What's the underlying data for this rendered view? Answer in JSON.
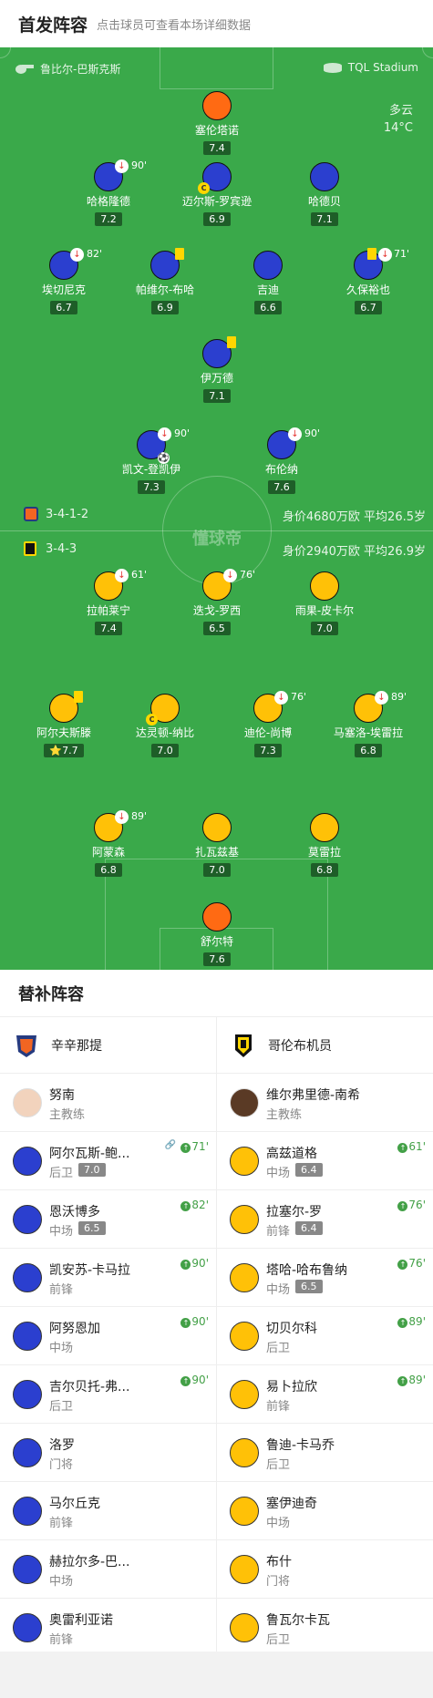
{
  "header": {
    "title": "首发阵容",
    "subtitle": "点击球员可查看本场详细数据"
  },
  "venue": {
    "referee": "鲁比尔-巴斯克斯",
    "stadium": "TQL Stadium"
  },
  "weather": {
    "condition": "多云",
    "temp": "14°C"
  },
  "teams": {
    "home": {
      "formation": "3-4-1-2",
      "value": "身价4680万欧 平均26.5岁"
    },
    "away": {
      "formation": "3-4-3",
      "value": "身价2940万欧 平均26.9岁"
    }
  },
  "watermark": "懂球帝",
  "home_players": [
    {
      "name": "塞伦塔诺",
      "rating": "7.4"
    },
    {
      "name": "哈格隆德",
      "rating": "7.2",
      "sub": "90'"
    },
    {
      "name": "迈尔斯-罗宾逊",
      "rating": "6.9"
    },
    {
      "name": "哈德贝",
      "rating": "7.1"
    },
    {
      "name": "埃切尼克",
      "rating": "6.7",
      "sub": "82'"
    },
    {
      "name": "帕维尔-布哈",
      "rating": "6.9"
    },
    {
      "name": "吉迪",
      "rating": "6.6"
    },
    {
      "name": "久保裕也",
      "rating": "6.7",
      "sub": "71'"
    },
    {
      "name": "伊万德",
      "rating": "7.1"
    },
    {
      "name": "凯文-登凯伊",
      "rating": "7.3",
      "sub": "90'"
    },
    {
      "name": "布伦纳",
      "rating": "7.6",
      "sub": "90'"
    }
  ],
  "away_players": [
    {
      "name": "拉帕莱宁",
      "rating": "7.4",
      "sub": "61'"
    },
    {
      "name": "迭戈-罗西",
      "rating": "6.5",
      "sub": "76'"
    },
    {
      "name": "雨果-皮卡尔",
      "rating": "7.0"
    },
    {
      "name": "阿尔夫斯滕",
      "rating": "7.7"
    },
    {
      "name": "达灵顿-纳比",
      "rating": "7.0"
    },
    {
      "name": "迪伦-尚博",
      "rating": "7.3",
      "sub": "76'"
    },
    {
      "name": "马塞洛-埃雷拉",
      "rating": "6.8",
      "sub": "89'"
    },
    {
      "name": "阿蒙森",
      "rating": "6.8",
      "sub": "89'"
    },
    {
      "name": "扎瓦兹基",
      "rating": "7.0"
    },
    {
      "name": "莫雷拉",
      "rating": "6.8"
    },
    {
      "name": "舒尔特",
      "rating": "7.6"
    }
  ],
  "subs_title": "替补阵容",
  "home_bench": {
    "team": "辛辛那提",
    "coach": {
      "name": "努南",
      "role": "主教练"
    },
    "players": [
      {
        "name": "阿尔瓦斯-鲍...",
        "pos": "后卫",
        "rating": "7.0",
        "min": "71'"
      },
      {
        "name": "恩沃博多",
        "pos": "中场",
        "rating": "6.5",
        "min": "82'"
      },
      {
        "name": "凯安苏-卡马拉",
        "pos": "前锋",
        "min": "90'"
      },
      {
        "name": "阿努恩加",
        "pos": "中场",
        "min": "90'"
      },
      {
        "name": "吉尔贝托-弗...",
        "pos": "后卫",
        "min": "90'"
      },
      {
        "name": "洛罗",
        "pos": "门将"
      },
      {
        "name": "马尔丘克",
        "pos": "前锋"
      },
      {
        "name": "赫拉尔多-巴...",
        "pos": "中场"
      },
      {
        "name": "奥雷利亚诺",
        "pos": "前锋"
      }
    ]
  },
  "away_bench": {
    "team": "哥伦布机员",
    "coach": {
      "name": "维尔弗里德-南希",
      "role": "主教练"
    },
    "players": [
      {
        "name": "高兹道格",
        "pos": "中场",
        "rating": "6.4",
        "min": "61'"
      },
      {
        "name": "拉塞尔-罗",
        "pos": "前锋",
        "rating": "6.4",
        "min": "76'"
      },
      {
        "name": "塔哈-哈布鲁纳",
        "pos": "中场",
        "rating": "6.5",
        "min": "76'"
      },
      {
        "name": "切贝尔科",
        "pos": "后卫",
        "min": "89'"
      },
      {
        "name": "易卜拉欣",
        "pos": "前锋",
        "min": "89'"
      },
      {
        "name": "鲁迪-卡马乔",
        "pos": "后卫"
      },
      {
        "name": "塞伊迪奇",
        "pos": "中场"
      },
      {
        "name": "布什",
        "pos": "门将"
      },
      {
        "name": "鲁瓦尔卡瓦",
        "pos": "后卫"
      }
    ]
  },
  "colors": {
    "pitch": "#3aa94a",
    "home": "#2b3fcf",
    "away": "#ffc107",
    "gk": "#ff6a13"
  }
}
